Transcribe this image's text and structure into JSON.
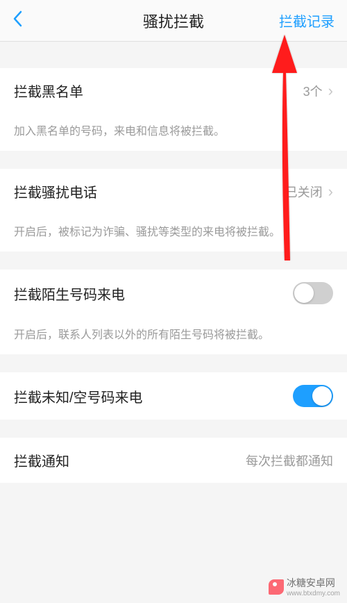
{
  "header": {
    "title": "骚扰拦截",
    "action": "拦截记录"
  },
  "rows": {
    "blacklist": {
      "title": "拦截黑名单",
      "value": "3个",
      "desc": "加入黑名单的号码，来电和信息将被拦截。"
    },
    "spamCall": {
      "title": "拦截骚扰电话",
      "value": "已关闭",
      "desc": "开启后，被标记为诈骗、骚扰等类型的来电将被拦截。"
    },
    "unknown": {
      "title": "拦截陌生号码来电",
      "desc": "开启后，联系人列表以外的所有陌生号码将被拦截。"
    },
    "empty": {
      "title": "拦截未知/空号码来电"
    },
    "notify": {
      "title": "拦截通知",
      "value": "每次拦截都通知"
    }
  },
  "watermark": {
    "text1": "冰糖安卓网",
    "text2": "www.btxdmy.com"
  }
}
